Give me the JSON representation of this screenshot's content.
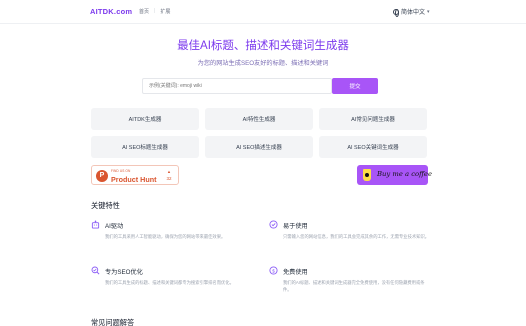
{
  "header": {
    "logo": "AITDK.com",
    "nav": [
      "首页",
      "扩展"
    ],
    "language": "简体中文"
  },
  "hero": {
    "title": "最佳AI标题、描述和关键词生成器",
    "subtitle": "为您的网站生成SEO友好的标题、描述和关键词"
  },
  "search": {
    "placeholder": "示例(关键词): emoji wiki",
    "submit_label": "提交"
  },
  "tools": [
    "AITDK生成器",
    "AI特性生成器",
    "AI常见问题生成器",
    "AI SEO标题生成器",
    "AI SEO描述生成器",
    "AI SEO关键词生成器"
  ],
  "badges": {
    "producthunt": {
      "small": "FIND US ON",
      "name": "Product Hunt",
      "count": "32"
    },
    "bmc_label": "Buy me a coffee"
  },
  "features_title": "关键特性",
  "features": [
    {
      "icon": "atom-icon",
      "title": "AI驱动",
      "desc": "我们的工具采用人工智能驱动，确保为您的网站带来最佳效果。"
    },
    {
      "icon": "check-circle-icon",
      "title": "易于使用",
      "desc": "只需输入您的网站信息，我们的工具会完成其余的工作，无需专业技术知识。"
    },
    {
      "icon": "search-check-icon",
      "title": "专为SEO优化",
      "desc": "我们的工具生成的标题、描述和关键词都专为搜索引擎排名而优化。"
    },
    {
      "icon": "dollar-circle-icon",
      "title": "免费使用",
      "desc": "我们的AI标题、描述和关键词生成器完全免费使用，没有任何隐藏费用或条件。"
    }
  ],
  "faq_title": "常见问题解答",
  "colors": {
    "accent": "#7c3aed",
    "button": "#a855f7",
    "producthunt": "#da552f",
    "bmc_cup": "#fde047"
  }
}
